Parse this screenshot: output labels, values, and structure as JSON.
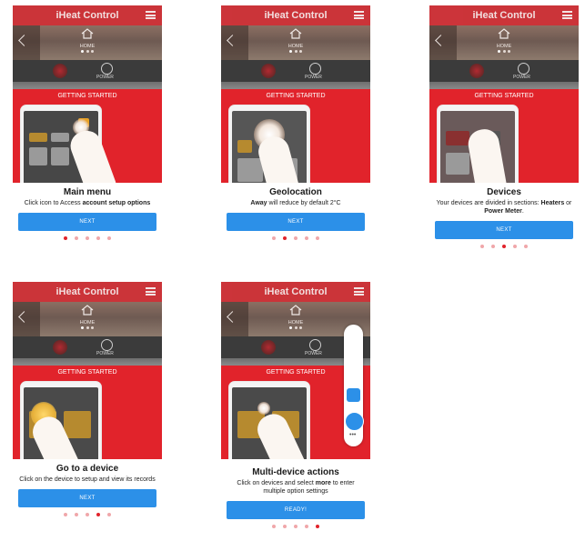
{
  "app": {
    "title": "iHeat Control"
  },
  "header": {
    "home_label": "HOME",
    "power_label": "POWER"
  },
  "banner": {
    "label": "GETTING STARTED"
  },
  "screens": [
    {
      "title": "Main menu",
      "desc_a": "Click icon to Access ",
      "desc_b": "account setup options",
      "desc_c": "",
      "button": "NEXT",
      "active_dot": 1
    },
    {
      "title": "Geolocation",
      "desc_a": "",
      "desc_b": "Away",
      "desc_c": " will reduce by default 2°C",
      "button": "NEXT",
      "active_dot": 2
    },
    {
      "title": "Devices",
      "desc_a": "Your devices are divided in sections: ",
      "desc_b": "Heaters",
      "desc_c": " or ",
      "desc_d": "Power Meter",
      "desc_e": ".",
      "button": "NEXT",
      "active_dot": 3
    },
    {
      "title": "Go to a device",
      "desc_a": "Click on the device to setup and view its records",
      "button": "NEXT",
      "active_dot": 4
    },
    {
      "title": "Multi-device actions",
      "desc_a": "Click on devices and select ",
      "desc_b": "more",
      "desc_c": " to enter multiple option settings",
      "button": "READY!",
      "active_dot": 5
    }
  ],
  "colors": {
    "brand_red": "#e1232b",
    "button_blue": "#2c90e8",
    "dark_bar": "#3b3b3b"
  },
  "icons": [
    "menu-icon",
    "back-chevron-icon",
    "home-icon",
    "heater-icon",
    "power-icon",
    "hand-pointer-icon",
    "music-icon",
    "bell-icon",
    "more-icon"
  ]
}
